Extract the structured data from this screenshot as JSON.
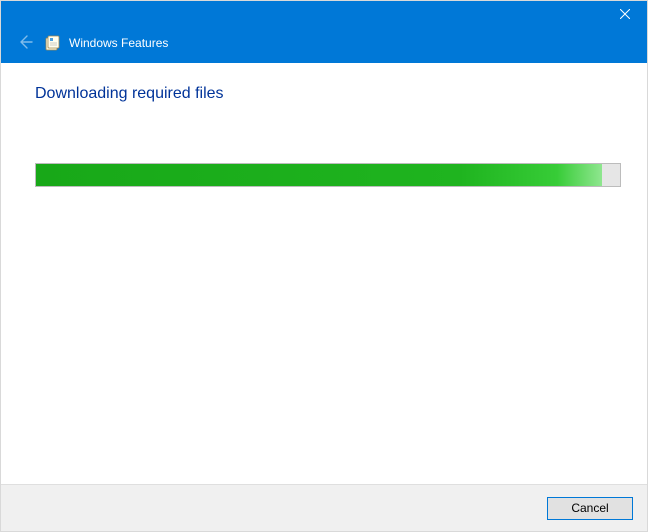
{
  "window": {
    "title": "Windows Features"
  },
  "content": {
    "heading": "Downloading required files",
    "progress_percent": 97
  },
  "footer": {
    "cancel_label": "Cancel"
  },
  "colors": {
    "accent": "#0078d7",
    "heading": "#003399",
    "progress": "#1fb41f"
  }
}
